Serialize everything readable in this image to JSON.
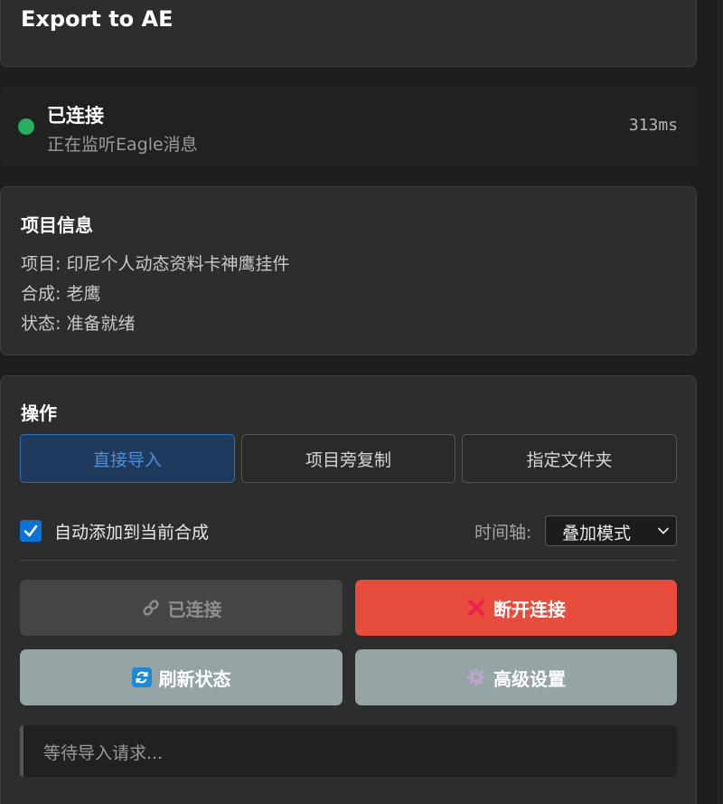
{
  "header": {
    "title": "Export to AE"
  },
  "connection": {
    "title": "已连接",
    "subtitle": "正在监听Eagle消息",
    "latency": "313ms",
    "status_color": "#27ae60"
  },
  "project_info": {
    "heading": "项目信息",
    "project_line": "项目: 印尼个人动态资料卡神鹰挂件",
    "composition_line": "合成: 老鹰",
    "status_line": "状态: 准备就绪"
  },
  "operations": {
    "heading": "操作",
    "modes": [
      {
        "label": "直接导入",
        "active": true
      },
      {
        "label": "项目旁复制",
        "active": false
      },
      {
        "label": "指定文件夹",
        "active": false
      }
    ],
    "auto_add_label": "自动添加到当前合成",
    "auto_add_checked": true,
    "timeline_label": "时间轴:",
    "timeline_value": "叠加模式",
    "buttons": {
      "connected": {
        "label": "已连接",
        "icon": "link-icon",
        "color": "#454545"
      },
      "disconnect": {
        "label": "断开连接",
        "icon": "close-icon",
        "color": "#e74c3c"
      },
      "refresh": {
        "label": "刷新状态",
        "icon": "refresh-icon",
        "color": "#95a5a6"
      },
      "advanced": {
        "label": "高级设置",
        "icon": "gear-icon",
        "color": "#95a5a6"
      }
    },
    "log_text": "等待导入请求..."
  }
}
